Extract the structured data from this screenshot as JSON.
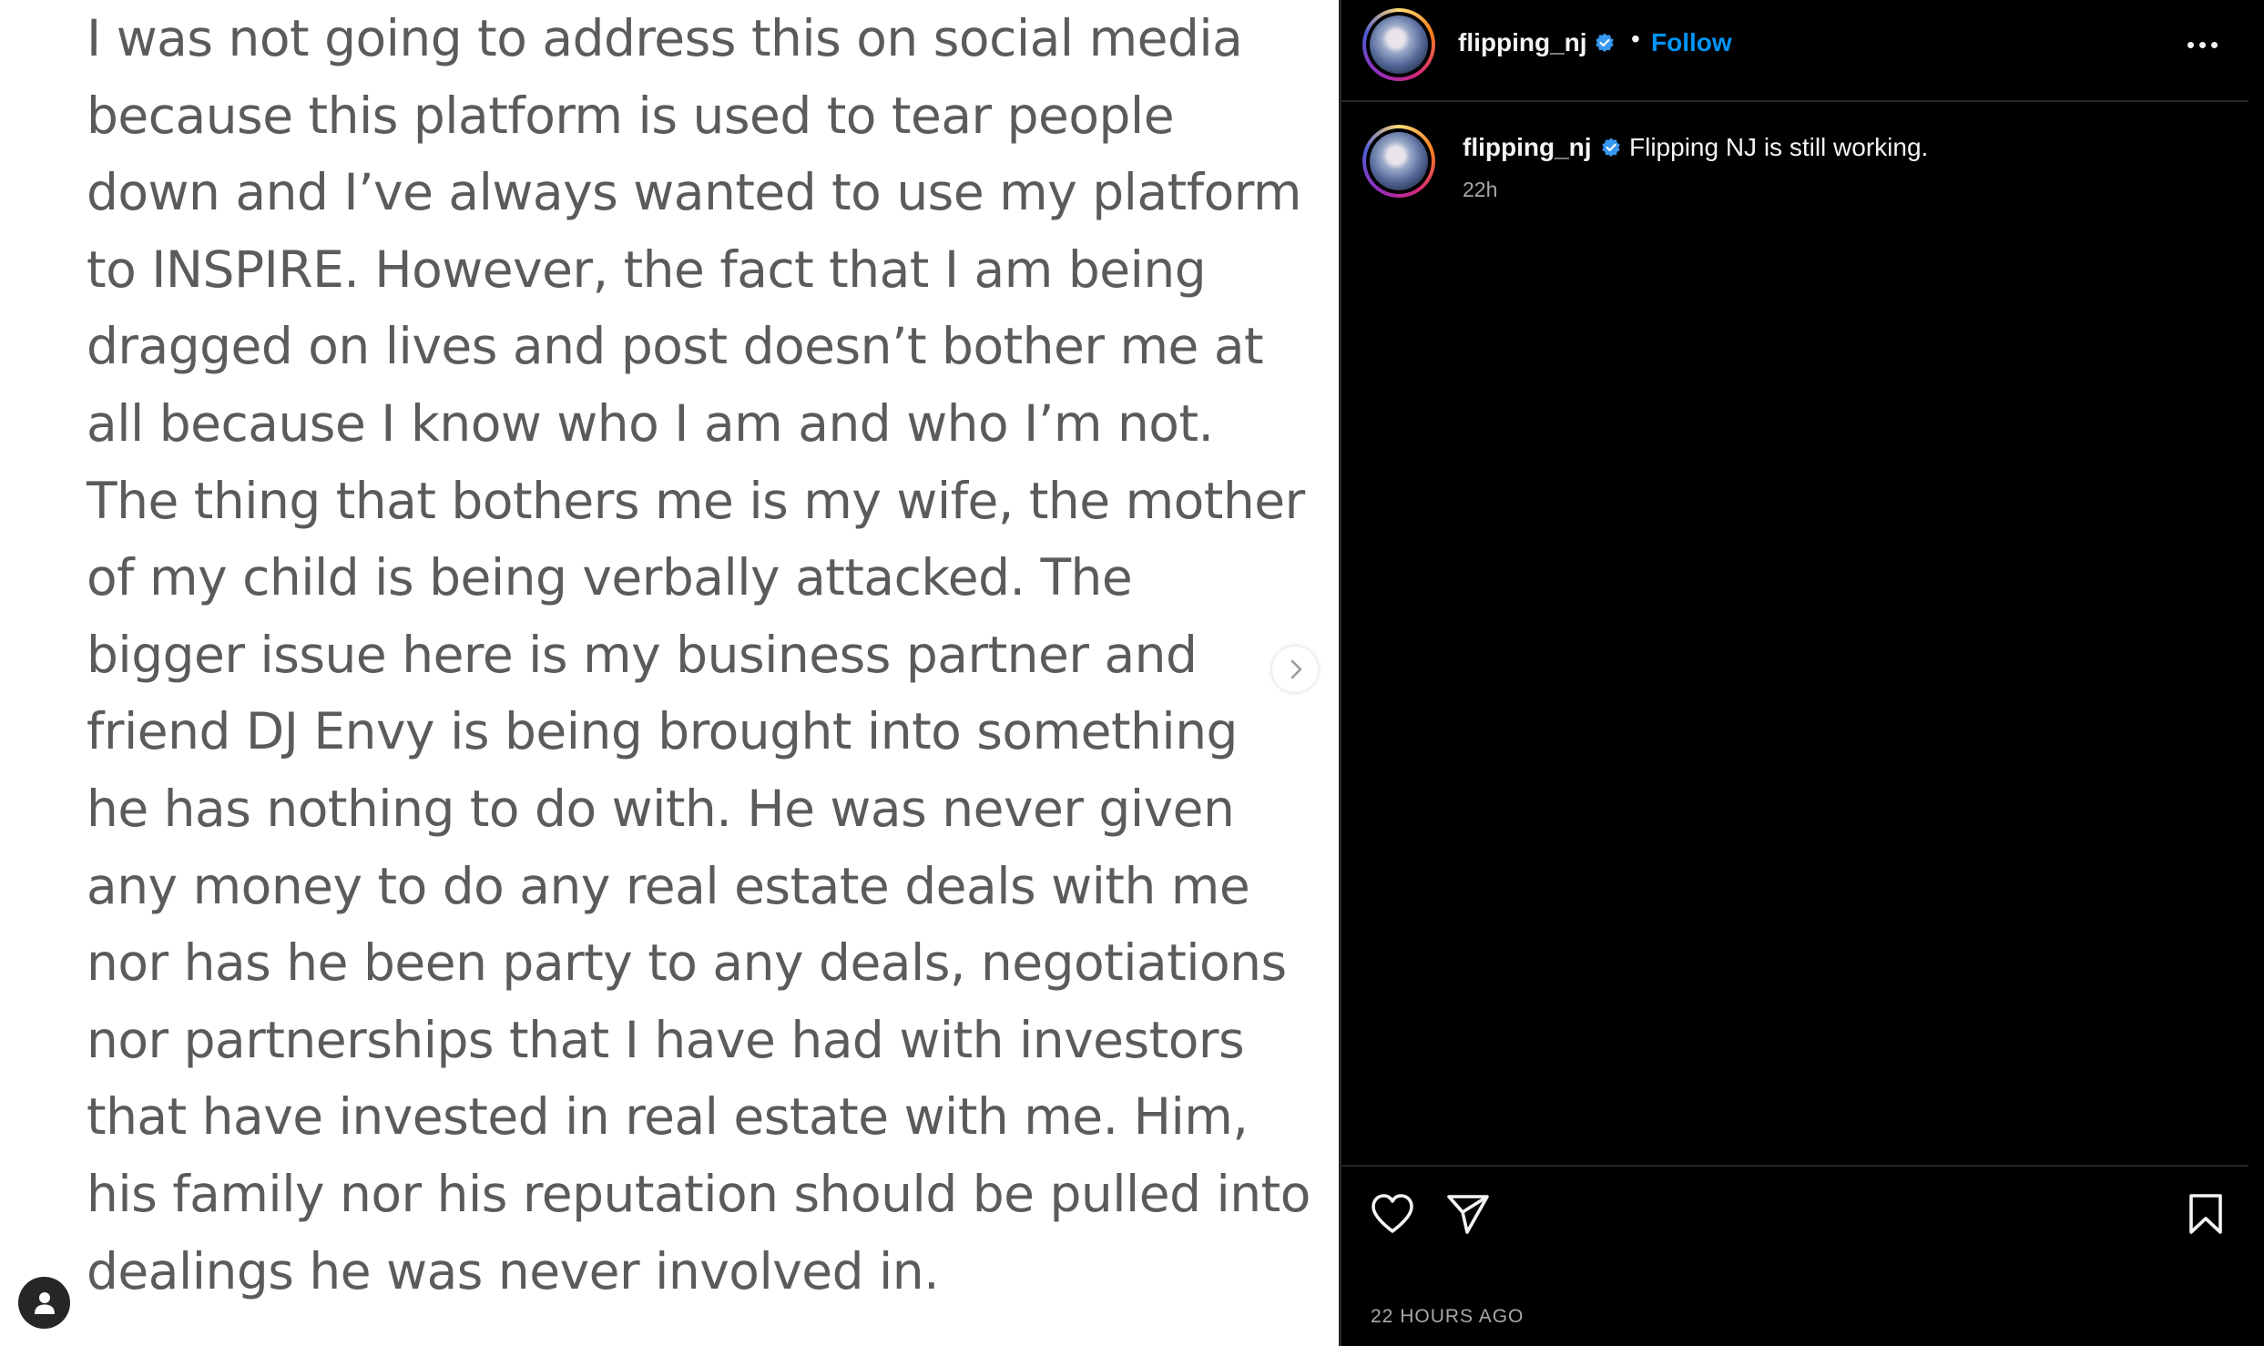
{
  "post_image": {
    "statement_lines": [
      "I was not going to address this on social media",
      "because this platform is used to tear people",
      "down and I’ve always wanted to use my platform",
      "to INSPIRE. However, the fact that I am being",
      "dragged on lives and post doesn’t bother me at",
      "all because I know who I am and who I’m not.",
      "The thing that bothers me is my wife, the mother",
      "of my child is being verbally attacked. The",
      "bigger issue here is my business partner and",
      "friend DJ Envy is being brought into something",
      "he has nothing to do with. He was never given",
      "any money to do any real estate deals with me",
      "nor has he been party to any deals, negotiations",
      "nor partnerships that I have had with investors",
      "that have invested in real estate with me. Him,",
      "his family nor his reputation should be pulled into",
      "dealings he was never involved in."
    ],
    "next_icon": "chevron-right-icon",
    "tag_icon": "user-tag-icon"
  },
  "header": {
    "username": "flipping_nj",
    "separator": "•",
    "follow_label": "Follow",
    "verified_icon": "verified-badge-icon",
    "more_icon": "more-options-icon"
  },
  "caption": {
    "username": "flipping_nj",
    "text": "Flipping NJ is still working.",
    "time": "22h"
  },
  "actions": {
    "like_icon": "heart-icon",
    "share_icon": "send-icon",
    "save_icon": "bookmark-icon"
  },
  "post_date": "22 HOURS AGO",
  "colors": {
    "accent": "#0095f6",
    "verified": "#3897f0",
    "background": "#000000",
    "text": "#f5f5f5",
    "secondary_text": "#a8a8a8",
    "statement_text": "#5b5b5b"
  }
}
